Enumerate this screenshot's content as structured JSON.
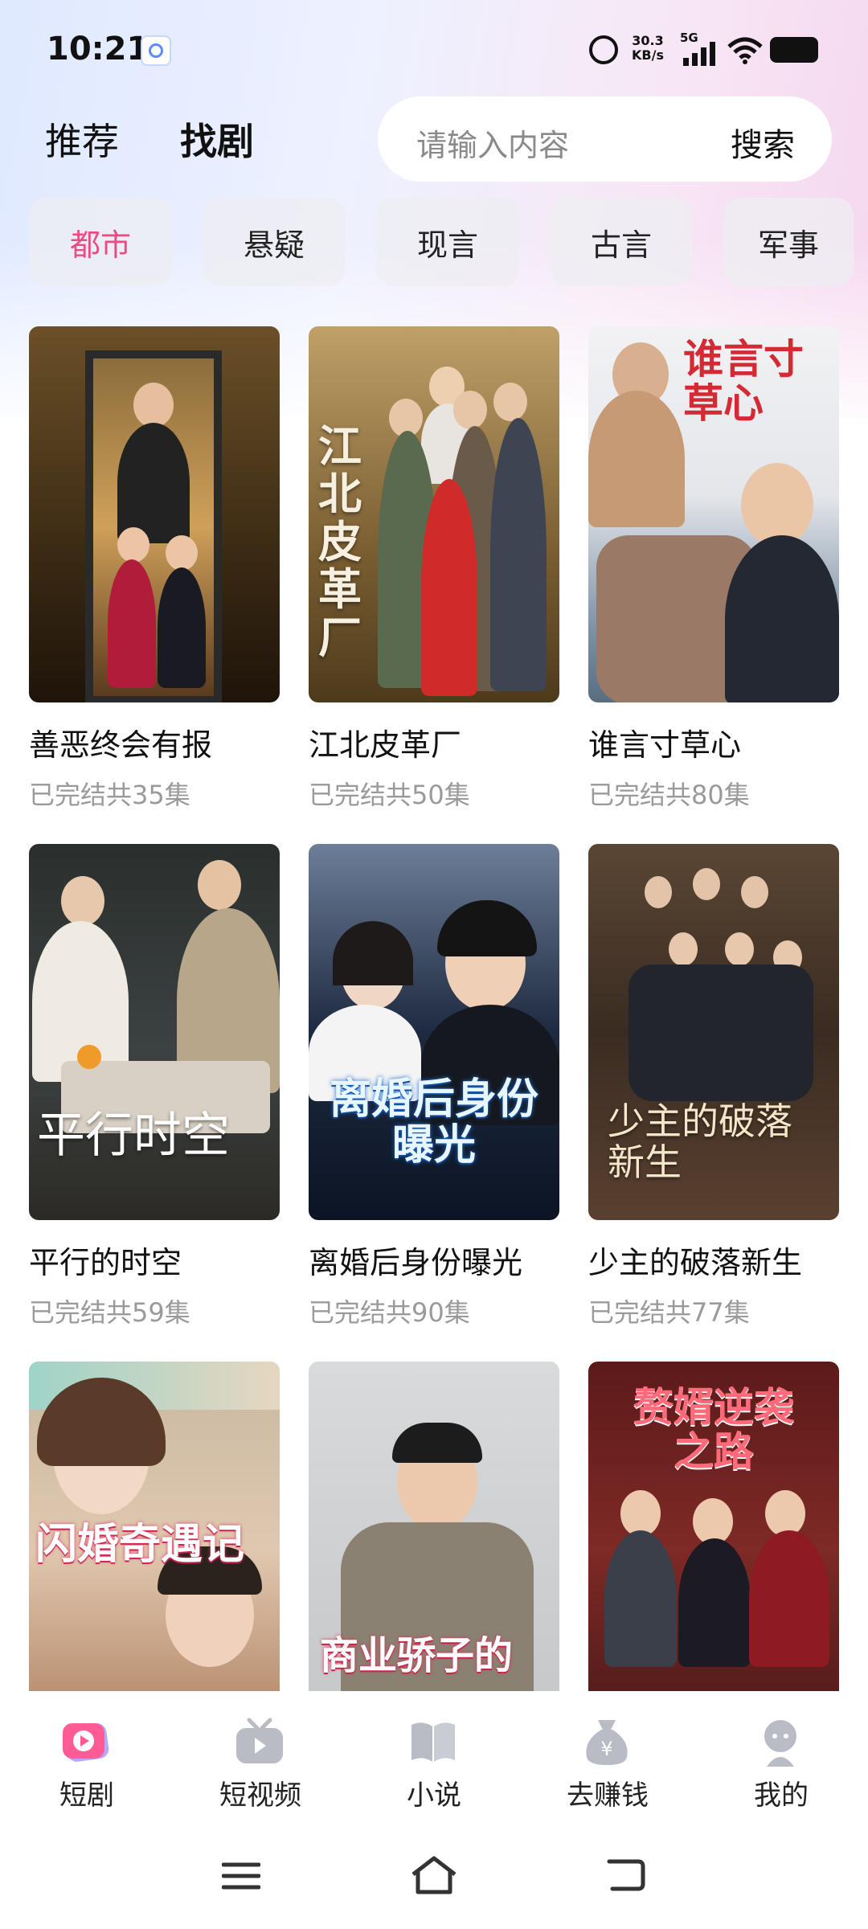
{
  "status_bar": {
    "time": "10:21",
    "net_speed_value": "30.3",
    "net_speed_unit": "KB/s",
    "network": "5G"
  },
  "header": {
    "tabs": [
      {
        "label": "推荐",
        "active": false
      },
      {
        "label": "找剧",
        "active": true
      }
    ],
    "search": {
      "placeholder": "请输入内容",
      "button_label": "搜索"
    }
  },
  "categories": [
    {
      "label": "都市",
      "active": true
    },
    {
      "label": "悬疑",
      "active": false
    },
    {
      "label": "现言",
      "active": false
    },
    {
      "label": "古言",
      "active": false
    },
    {
      "label": "军事",
      "active": false
    }
  ],
  "dramas": [
    {
      "title": "善恶终会有报",
      "status": "已完结共35集",
      "poster_text": ""
    },
    {
      "title": "江北皮革厂",
      "status": "已完结共50集",
      "poster_text": "江北皮革厂"
    },
    {
      "title": "谁言寸草心",
      "status": "已完结共80集",
      "poster_text": "谁言寸草心"
    },
    {
      "title": "平行的时空",
      "status": "已完结共59集",
      "poster_text": "平行时空"
    },
    {
      "title": "离婚后身份曝光",
      "status": "已完结共90集",
      "poster_text": "离婚后身份曝光"
    },
    {
      "title": "少主的破落新生",
      "status": "已完结共77集",
      "poster_text": "少主的破落新生"
    },
    {
      "title": "",
      "status": "",
      "poster_text": "闪婚奇遇记"
    },
    {
      "title": "",
      "status": "",
      "poster_text": "商业骄子的"
    },
    {
      "title": "",
      "status": "",
      "poster_text": "赘婿逆袭之路"
    }
  ],
  "bottom_nav": [
    {
      "label": "短剧",
      "icon": "short-drama-icon",
      "active": true
    },
    {
      "label": "短视频",
      "icon": "tv-icon",
      "active": false
    },
    {
      "label": "小说",
      "icon": "book-icon",
      "active": false
    },
    {
      "label": "去赚钱",
      "icon": "money-bag-icon",
      "active": false
    },
    {
      "label": "我的",
      "icon": "profile-icon",
      "active": false
    }
  ],
  "colors": {
    "accent": "#ea4b86",
    "text_primary": "#111111",
    "text_secondary": "#9a9a9a"
  }
}
